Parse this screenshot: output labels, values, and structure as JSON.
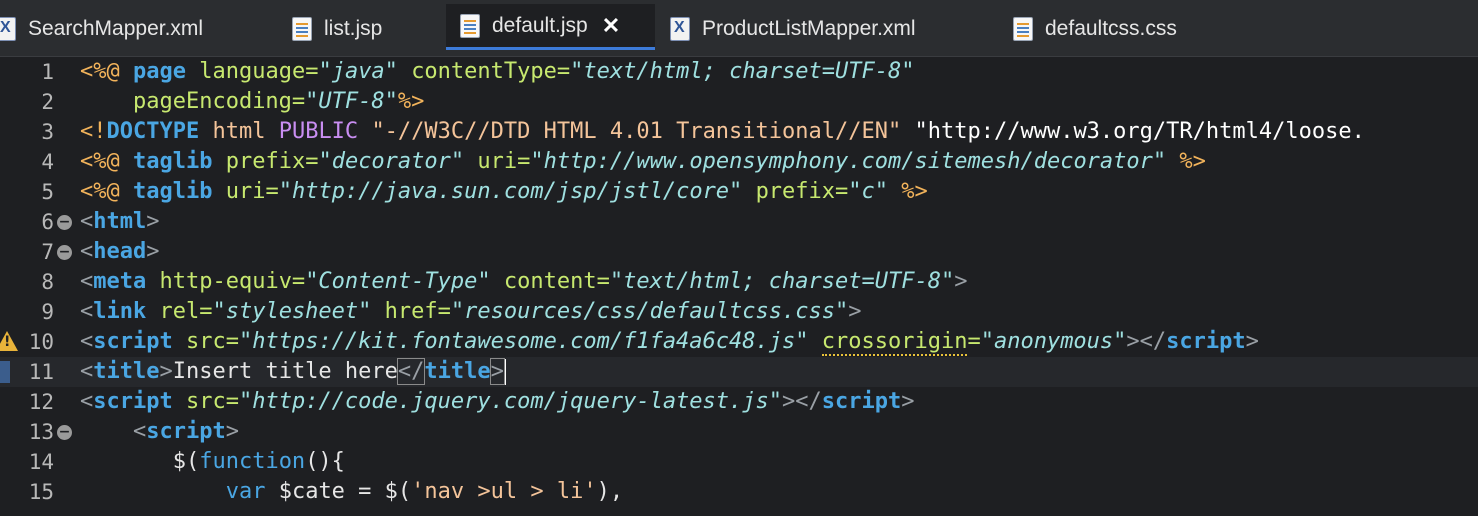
{
  "tabs": [
    {
      "label": "SearchMapper.xml",
      "icon": "xml-file-icon",
      "active": false
    },
    {
      "label": "list.jsp",
      "icon": "jsp-file-icon",
      "active": false
    },
    {
      "label": "default.jsp",
      "icon": "jsp-file-icon",
      "active": true
    },
    {
      "label": "ProductListMapper.xml",
      "icon": "xml-file-icon",
      "active": false
    },
    {
      "label": "defaultcss.css",
      "icon": "css-file-icon",
      "active": false
    }
  ],
  "close_glyph": "✕",
  "lines": [
    {
      "n": "1"
    },
    {
      "n": "2"
    },
    {
      "n": "3"
    },
    {
      "n": "4"
    },
    {
      "n": "5"
    },
    {
      "n": "6"
    },
    {
      "n": "7"
    },
    {
      "n": "8"
    },
    {
      "n": "9"
    },
    {
      "n": "10"
    },
    {
      "n": "11"
    },
    {
      "n": "12"
    },
    {
      "n": "13"
    },
    {
      "n": "14"
    },
    {
      "n": "15"
    }
  ],
  "code": {
    "l1": {
      "a": "<%@",
      "b": "page",
      "c": "language=",
      "d": "\"java\"",
      "e": "contentType=",
      "f": "\"text/html; charset=UTF-8\""
    },
    "l2": {
      "a": "pageEncoding=",
      "b": "\"UTF-8\"",
      "c": "%>"
    },
    "l3": {
      "a": "<!",
      "b": "DOCTYPE",
      "c": "html",
      "d": "PUBLIC",
      "e": "\"-//W3C//DTD HTML 4.01 Transitional//EN\"",
      "f": "\"http://www.w3.org/TR/html4/loose."
    },
    "l4": {
      "a": "<%@",
      "b": "taglib",
      "c": "prefix=",
      "d": "\"decorator\"",
      "e": "uri=",
      "f": "\"http://www.opensymphony.com/sitemesh/decorator\"",
      "g": "%>"
    },
    "l5": {
      "a": "<%@",
      "b": "taglib",
      "c": "uri=",
      "d": "\"http://java.sun.com/jsp/jstl/core\"",
      "e": "prefix=",
      "f": "\"c\"",
      "g": "%>"
    },
    "l6": {
      "a": "<",
      "b": "html",
      "c": ">"
    },
    "l7": {
      "a": "<",
      "b": "head",
      "c": ">"
    },
    "l8": {
      "a": "<",
      "b": "meta",
      "c": "http-equiv=",
      "d": "\"Content-Type\"",
      "e": "content=",
      "f": "\"text/html; charset=UTF-8\"",
      "g": ">"
    },
    "l9": {
      "a": "<",
      "b": "link",
      "c": "rel=",
      "d": "\"stylesheet\"",
      "e": "href=",
      "f": "\"resources/css/defaultcss.css\"",
      "g": ">"
    },
    "l10": {
      "a": "<",
      "b": "script",
      "c": "src=",
      "d": "\"https://kit.fontawesome.com/f1fa4a6c48.js\"",
      "e": "crossorigin",
      "f": "=",
      "g": "\"anonymous\"",
      "h": "></",
      "i": "script",
      "j": ">"
    },
    "l11": {
      "a": "<",
      "b": "title",
      "c": ">",
      "d": "Insert title here",
      "e": "</",
      "f": "title",
      "g": ">"
    },
    "l12": {
      "a": "<",
      "b": "script",
      "c": "src=",
      "d": "\"http://code.jquery.com/jquery-latest.js\"",
      "e": "></",
      "f": "script",
      "g": ">"
    },
    "l13": {
      "a": "<",
      "b": "script",
      "c": ">"
    },
    "l14": {
      "a": "$(",
      "b": "function",
      "c": "(){"
    },
    "l15": {
      "a": "var",
      "b": "$cate = $(",
      "c": "'nav >ul > li'",
      "d": "),"
    }
  }
}
